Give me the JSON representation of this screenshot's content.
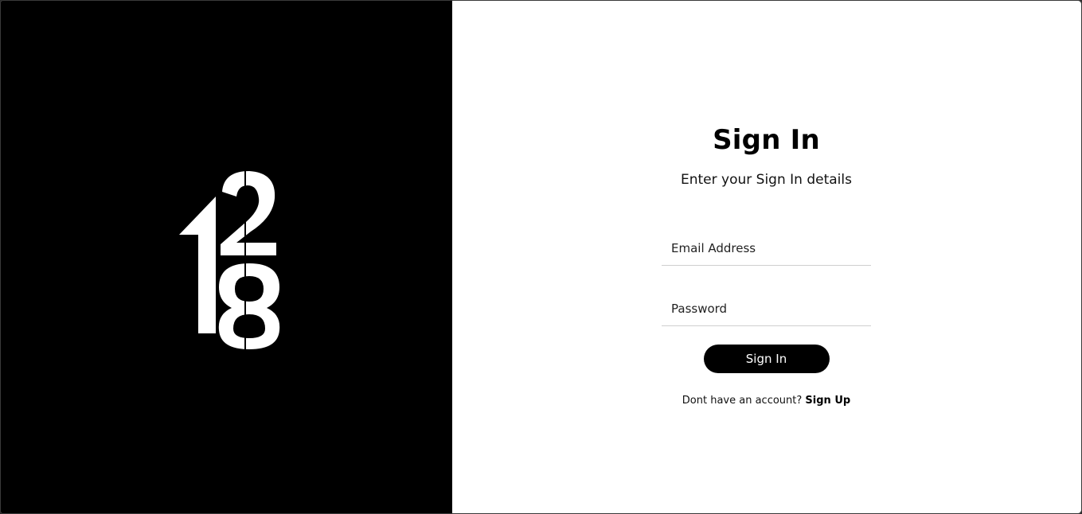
{
  "logo": {
    "icon": "128-logo-icon",
    "color": "#ffffff"
  },
  "signin": {
    "title": "Sign In",
    "subtitle": "Enter your Sign In details",
    "email_placeholder": "Email Address",
    "password_placeholder": "Password",
    "button_label": "Sign In",
    "no_account_text": "Dont have an account?",
    "signup_link": "Sign Up"
  },
  "colors": {
    "left_panel": "#000000",
    "right_panel": "#ffffff",
    "button_bg": "#000000",
    "button_text": "#ffffff"
  }
}
